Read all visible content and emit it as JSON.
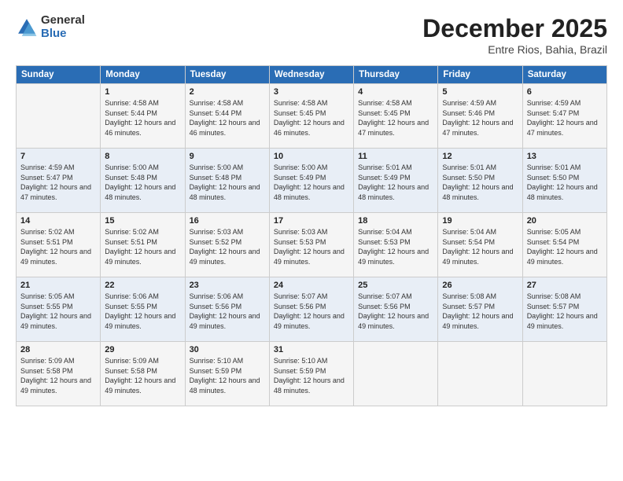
{
  "logo": {
    "general": "General",
    "blue": "Blue"
  },
  "title": "December 2025",
  "subtitle": "Entre Rios, Bahia, Brazil",
  "days_header": [
    "Sunday",
    "Monday",
    "Tuesday",
    "Wednesday",
    "Thursday",
    "Friday",
    "Saturday"
  ],
  "weeks": [
    [
      {
        "day": "",
        "sunrise": "",
        "sunset": "",
        "daylight": ""
      },
      {
        "day": "1",
        "sunrise": "Sunrise: 4:58 AM",
        "sunset": "Sunset: 5:44 PM",
        "daylight": "Daylight: 12 hours and 46 minutes."
      },
      {
        "day": "2",
        "sunrise": "Sunrise: 4:58 AM",
        "sunset": "Sunset: 5:44 PM",
        "daylight": "Daylight: 12 hours and 46 minutes."
      },
      {
        "day": "3",
        "sunrise": "Sunrise: 4:58 AM",
        "sunset": "Sunset: 5:45 PM",
        "daylight": "Daylight: 12 hours and 46 minutes."
      },
      {
        "day": "4",
        "sunrise": "Sunrise: 4:58 AM",
        "sunset": "Sunset: 5:45 PM",
        "daylight": "Daylight: 12 hours and 47 minutes."
      },
      {
        "day": "5",
        "sunrise": "Sunrise: 4:59 AM",
        "sunset": "Sunset: 5:46 PM",
        "daylight": "Daylight: 12 hours and 47 minutes."
      },
      {
        "day": "6",
        "sunrise": "Sunrise: 4:59 AM",
        "sunset": "Sunset: 5:47 PM",
        "daylight": "Daylight: 12 hours and 47 minutes."
      }
    ],
    [
      {
        "day": "7",
        "sunrise": "Sunrise: 4:59 AM",
        "sunset": "Sunset: 5:47 PM",
        "daylight": "Daylight: 12 hours and 47 minutes."
      },
      {
        "day": "8",
        "sunrise": "Sunrise: 5:00 AM",
        "sunset": "Sunset: 5:48 PM",
        "daylight": "Daylight: 12 hours and 48 minutes."
      },
      {
        "day": "9",
        "sunrise": "Sunrise: 5:00 AM",
        "sunset": "Sunset: 5:48 PM",
        "daylight": "Daylight: 12 hours and 48 minutes."
      },
      {
        "day": "10",
        "sunrise": "Sunrise: 5:00 AM",
        "sunset": "Sunset: 5:49 PM",
        "daylight": "Daylight: 12 hours and 48 minutes."
      },
      {
        "day": "11",
        "sunrise": "Sunrise: 5:01 AM",
        "sunset": "Sunset: 5:49 PM",
        "daylight": "Daylight: 12 hours and 48 minutes."
      },
      {
        "day": "12",
        "sunrise": "Sunrise: 5:01 AM",
        "sunset": "Sunset: 5:50 PM",
        "daylight": "Daylight: 12 hours and 48 minutes."
      },
      {
        "day": "13",
        "sunrise": "Sunrise: 5:01 AM",
        "sunset": "Sunset: 5:50 PM",
        "daylight": "Daylight: 12 hours and 48 minutes."
      }
    ],
    [
      {
        "day": "14",
        "sunrise": "Sunrise: 5:02 AM",
        "sunset": "Sunset: 5:51 PM",
        "daylight": "Daylight: 12 hours and 49 minutes."
      },
      {
        "day": "15",
        "sunrise": "Sunrise: 5:02 AM",
        "sunset": "Sunset: 5:51 PM",
        "daylight": "Daylight: 12 hours and 49 minutes."
      },
      {
        "day": "16",
        "sunrise": "Sunrise: 5:03 AM",
        "sunset": "Sunset: 5:52 PM",
        "daylight": "Daylight: 12 hours and 49 minutes."
      },
      {
        "day": "17",
        "sunrise": "Sunrise: 5:03 AM",
        "sunset": "Sunset: 5:53 PM",
        "daylight": "Daylight: 12 hours and 49 minutes."
      },
      {
        "day": "18",
        "sunrise": "Sunrise: 5:04 AM",
        "sunset": "Sunset: 5:53 PM",
        "daylight": "Daylight: 12 hours and 49 minutes."
      },
      {
        "day": "19",
        "sunrise": "Sunrise: 5:04 AM",
        "sunset": "Sunset: 5:54 PM",
        "daylight": "Daylight: 12 hours and 49 minutes."
      },
      {
        "day": "20",
        "sunrise": "Sunrise: 5:05 AM",
        "sunset": "Sunset: 5:54 PM",
        "daylight": "Daylight: 12 hours and 49 minutes."
      }
    ],
    [
      {
        "day": "21",
        "sunrise": "Sunrise: 5:05 AM",
        "sunset": "Sunset: 5:55 PM",
        "daylight": "Daylight: 12 hours and 49 minutes."
      },
      {
        "day": "22",
        "sunrise": "Sunrise: 5:06 AM",
        "sunset": "Sunset: 5:55 PM",
        "daylight": "Daylight: 12 hours and 49 minutes."
      },
      {
        "day": "23",
        "sunrise": "Sunrise: 5:06 AM",
        "sunset": "Sunset: 5:56 PM",
        "daylight": "Daylight: 12 hours and 49 minutes."
      },
      {
        "day": "24",
        "sunrise": "Sunrise: 5:07 AM",
        "sunset": "Sunset: 5:56 PM",
        "daylight": "Daylight: 12 hours and 49 minutes."
      },
      {
        "day": "25",
        "sunrise": "Sunrise: 5:07 AM",
        "sunset": "Sunset: 5:56 PM",
        "daylight": "Daylight: 12 hours and 49 minutes."
      },
      {
        "day": "26",
        "sunrise": "Sunrise: 5:08 AM",
        "sunset": "Sunset: 5:57 PM",
        "daylight": "Daylight: 12 hours and 49 minutes."
      },
      {
        "day": "27",
        "sunrise": "Sunrise: 5:08 AM",
        "sunset": "Sunset: 5:57 PM",
        "daylight": "Daylight: 12 hours and 49 minutes."
      }
    ],
    [
      {
        "day": "28",
        "sunrise": "Sunrise: 5:09 AM",
        "sunset": "Sunset: 5:58 PM",
        "daylight": "Daylight: 12 hours and 49 minutes."
      },
      {
        "day": "29",
        "sunrise": "Sunrise: 5:09 AM",
        "sunset": "Sunset: 5:58 PM",
        "daylight": "Daylight: 12 hours and 49 minutes."
      },
      {
        "day": "30",
        "sunrise": "Sunrise: 5:10 AM",
        "sunset": "Sunset: 5:59 PM",
        "daylight": "Daylight: 12 hours and 48 minutes."
      },
      {
        "day": "31",
        "sunrise": "Sunrise: 5:10 AM",
        "sunset": "Sunset: 5:59 PM",
        "daylight": "Daylight: 12 hours and 48 minutes."
      },
      {
        "day": "",
        "sunrise": "",
        "sunset": "",
        "daylight": ""
      },
      {
        "day": "",
        "sunrise": "",
        "sunset": "",
        "daylight": ""
      },
      {
        "day": "",
        "sunrise": "",
        "sunset": "",
        "daylight": ""
      }
    ]
  ]
}
